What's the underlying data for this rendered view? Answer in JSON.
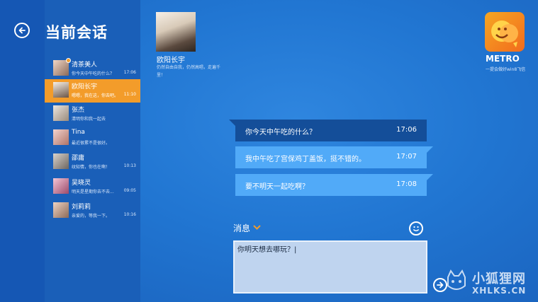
{
  "page_title": "当前会话",
  "contacts": [
    {
      "name": "清茶美人",
      "preview": "你今天中午吃的什么？",
      "time": "17:06",
      "badge": true,
      "active": false
    },
    {
      "name": "欧阳长宇",
      "preview": "嗯嗯，我在这，你去吧。",
      "time": "11:10",
      "badge": false,
      "active": true
    },
    {
      "name": "张杰",
      "preview": "清明你和我一起去",
      "time": "",
      "badge": false,
      "active": false
    },
    {
      "name": "Tina",
      "preview": "最近很累不是很好。",
      "time": "",
      "badge": false,
      "active": false
    },
    {
      "name": "邵庸",
      "preview": "纹知情，你也在啊！",
      "time": "10:13",
      "badge": false,
      "active": false
    },
    {
      "name": "吴晓灵",
      "preview": "明天是星期你去不去...",
      "time": "09:05",
      "badge": false,
      "active": false
    },
    {
      "name": "刘莉莉",
      "preview": "亲爱的，等我一下。",
      "time": "10:16",
      "badge": false,
      "active": false
    }
  ],
  "chat": {
    "name": "欧阳长宇",
    "status": "仍然自由自我，仍然高唱，走遍千里！"
  },
  "app": {
    "title": "METRO",
    "subtitle": "一提会做好win8飞信"
  },
  "messages": [
    {
      "text": "你今天中午吃的什么？",
      "time": "17:06",
      "direction": "sent"
    },
    {
      "text": "我中午吃了宫保鸡丁盖饭，挺不错的。",
      "time": "17:07",
      "direction": "recv"
    },
    {
      "text": "要不明天一起吃啊？",
      "time": "17:08",
      "direction": "recv"
    }
  ],
  "composer": {
    "label": "消息",
    "value": "你明天想去哪玩？|"
  },
  "watermark": {
    "text": "小狐狸网",
    "url": "XHLKS.CN"
  },
  "colors": {
    "accent": "#f39c2a",
    "background": "#2176d2",
    "sent_bubble": "#144e99",
    "recv_bubble": "#51aaf8"
  },
  "icons": [
    "back-arrow-icon",
    "chevron-down-icon",
    "smiley-icon",
    "send-arrow-icon"
  ]
}
